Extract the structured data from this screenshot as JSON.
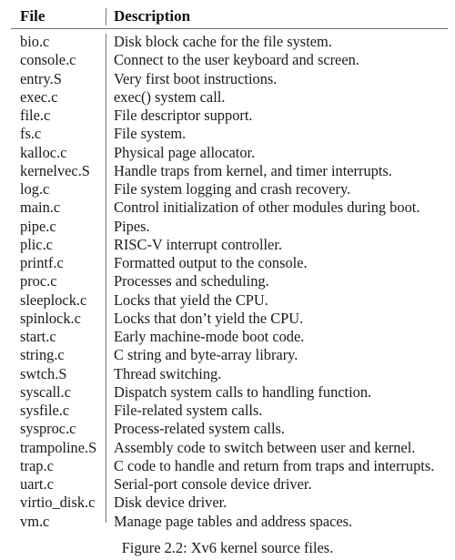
{
  "table": {
    "headers": {
      "file": "File",
      "description": "Description"
    },
    "rows": [
      {
        "file": "bio.c",
        "description": "Disk block cache for the file system."
      },
      {
        "file": "console.c",
        "description": "Connect to the user keyboard and screen."
      },
      {
        "file": "entry.S",
        "description": "Very first boot instructions."
      },
      {
        "file": "exec.c",
        "description": "exec() system call."
      },
      {
        "file": "file.c",
        "description": "File descriptor support."
      },
      {
        "file": "fs.c",
        "description": "File system."
      },
      {
        "file": "kalloc.c",
        "description": "Physical page allocator."
      },
      {
        "file": "kernelvec.S",
        "description": "Handle traps from kernel, and timer interrupts."
      },
      {
        "file": "log.c",
        "description": "File system logging and crash recovery."
      },
      {
        "file": "main.c",
        "description": "Control initialization of other modules during boot."
      },
      {
        "file": "pipe.c",
        "description": "Pipes."
      },
      {
        "file": "plic.c",
        "description": "RISC-V interrupt controller."
      },
      {
        "file": "printf.c",
        "description": "Formatted output to the console."
      },
      {
        "file": "proc.c",
        "description": "Processes and scheduling."
      },
      {
        "file": "sleeplock.c",
        "description": "Locks that yield the CPU."
      },
      {
        "file": "spinlock.c",
        "description": "Locks that don’t yield the CPU."
      },
      {
        "file": "start.c",
        "description": "Early machine-mode boot code."
      },
      {
        "file": "string.c",
        "description": "C string and byte-array library."
      },
      {
        "file": "swtch.S",
        "description": "Thread switching."
      },
      {
        "file": "syscall.c",
        "description": "Dispatch system calls to handling function."
      },
      {
        "file": "sysfile.c",
        "description": "File-related system calls."
      },
      {
        "file": "sysproc.c",
        "description": "Process-related system calls."
      },
      {
        "file": "trampoline.S",
        "description": "Assembly code to switch between user and kernel."
      },
      {
        "file": "trap.c",
        "description": "C code to handle and return from traps and interrupts."
      },
      {
        "file": "uart.c",
        "description": "Serial-port console device driver."
      },
      {
        "file": "virtio_disk.c",
        "description": "Disk device driver."
      },
      {
        "file": "vm.c",
        "description": "Manage page tables and address spaces."
      }
    ]
  },
  "caption": "Figure 2.2: Xv6 kernel source files."
}
